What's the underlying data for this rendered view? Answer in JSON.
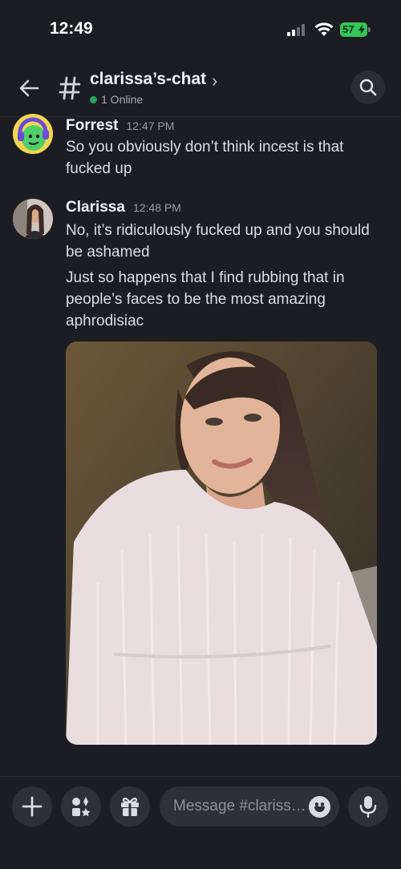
{
  "status_bar": {
    "time": "12:49",
    "battery": "57"
  },
  "header": {
    "channel_name": "clarissa’s-chat",
    "chevron": "›",
    "online_count": "1 Online",
    "icons": {
      "back": "arrow-left-icon",
      "hash": "hash-icon",
      "search": "search-icon"
    }
  },
  "messages": [
    {
      "author": "Forrest",
      "time": "12:47 PM",
      "lines": [
        "So you obviously don’t think incest is that fucked up"
      ]
    },
    {
      "author": "Clarissa",
      "time": "12:48 PM",
      "lines": [
        "No, it’s ridiculously fucked up and you should be ashamed",
        "Just so happens that I find rubbing that in people’s faces to be the most amazing aphrodisiac"
      ]
    }
  ],
  "composer": {
    "placeholder": "Message #clariss…",
    "icons": [
      "plus-icon",
      "apps-icon",
      "gift-icon",
      "emoji-icon",
      "microphone-icon"
    ]
  },
  "colors": {
    "background": "#1c1d22",
    "online": "#23a55a",
    "battery": "#34c759"
  }
}
